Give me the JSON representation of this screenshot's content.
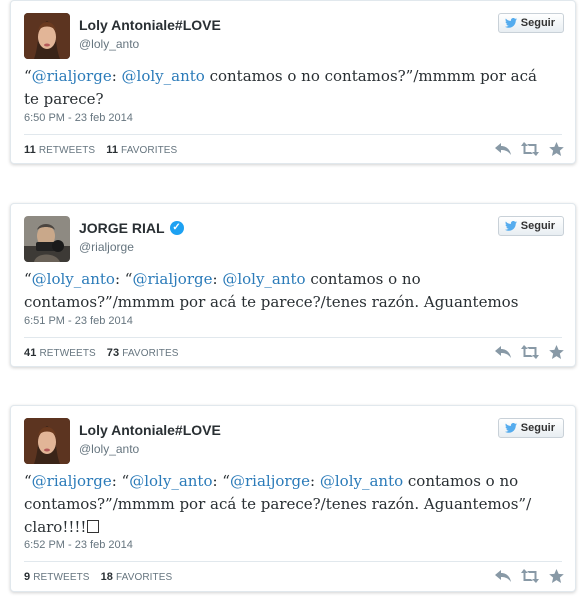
{
  "colors": {
    "mention": "#2b7bb9",
    "verified": "#1da1f2",
    "follow_bird": "#55acee"
  },
  "tweets": [
    {
      "name": "Loly Antoniale#LOVE",
      "handle": "@loly_anto",
      "verified": false,
      "follow_label": "Seguir",
      "text_parts": [
        {
          "t": "“"
        },
        {
          "t": "@rialjorge",
          "m": true
        },
        {
          "t": ": "
        },
        {
          "t": "@loly_anto",
          "m": true
        },
        {
          "t": " contamos o no contamos?”/mmmm por acá te parece?"
        }
      ],
      "date": "6:50 PM - 23 feb 2014",
      "retweets": "11",
      "retweets_label": "RETWEETS",
      "favorites": "11",
      "favorites_label": "FAVORITES"
    },
    {
      "name": "JORGE RIAL",
      "handle": "@rialjorge",
      "verified": true,
      "follow_label": "Seguir",
      "text_parts": [
        {
          "t": "“"
        },
        {
          "t": "@loly_anto",
          "m": true
        },
        {
          "t": ": “"
        },
        {
          "t": "@rialjorge",
          "m": true
        },
        {
          "t": ": "
        },
        {
          "t": "@loly_anto",
          "m": true
        },
        {
          "t": " contamos o no contamos?”/mmmm por acá te parece?/tenes razón. Aguantemos"
        }
      ],
      "date": "6:51 PM - 23 feb 2014",
      "retweets": "41",
      "retweets_label": "RETWEETS",
      "favorites": "73",
      "favorites_label": "FAVORITES"
    },
    {
      "name": "Loly Antoniale#LOVE",
      "handle": "@loly_anto",
      "verified": false,
      "follow_label": "Seguir",
      "text_parts": [
        {
          "t": "“"
        },
        {
          "t": "@rialjorge",
          "m": true
        },
        {
          "t": ": “"
        },
        {
          "t": "@loly_anto",
          "m": true
        },
        {
          "t": ": “"
        },
        {
          "t": "@rialjorge",
          "m": true
        },
        {
          "t": ": "
        },
        {
          "t": "@loly_anto",
          "m": true
        },
        {
          "t": " contamos o no contamos?”/mmmm por acá te parece?/tenes razón. Aguantemos”/ claro!!!!"
        }
      ],
      "trailing_glyph": true,
      "date": "6:52 PM - 23 feb 2014",
      "retweets": "9",
      "retweets_label": "RETWEETS",
      "favorites": "18",
      "favorites_label": "FAVORITES"
    }
  ]
}
